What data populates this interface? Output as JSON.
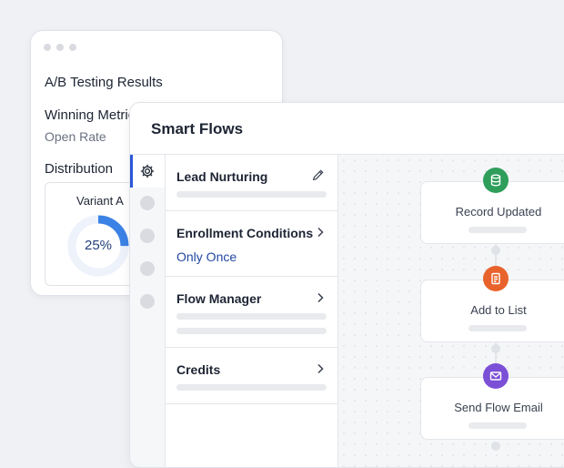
{
  "back_card": {
    "title": "A/B Testing Results",
    "winning_label": "Winning Metric",
    "winning_value": "Open Rate",
    "distribution_label": "Distribution",
    "variant": {
      "label": "Variant A",
      "percent_text": "25%",
      "percent": 25
    }
  },
  "main": {
    "title": "Smart Flows",
    "sections": [
      {
        "title": "Lead Nurturing",
        "action_icon": "pencil-icon"
      },
      {
        "title": "Enrollment Conditions",
        "value": "Only Once",
        "action_icon": "chevron-right-icon"
      },
      {
        "title": "Flow Manager",
        "action_icon": "chevron-right-icon"
      },
      {
        "title": "Credits",
        "action_icon": "chevron-right-icon"
      }
    ],
    "nodes": [
      {
        "label": "Record Updated",
        "icon": "database-icon",
        "color": "#2f9e5b"
      },
      {
        "label": "Add to List",
        "icon": "list-icon",
        "color": "#e8632b"
      },
      {
        "label": "Send Flow Email",
        "icon": "envelope-icon",
        "color": "#7b4fd6"
      }
    ]
  },
  "colors": {
    "accent": "#2b57d6",
    "link": "#2148a3",
    "donut": "#3b82e6"
  }
}
